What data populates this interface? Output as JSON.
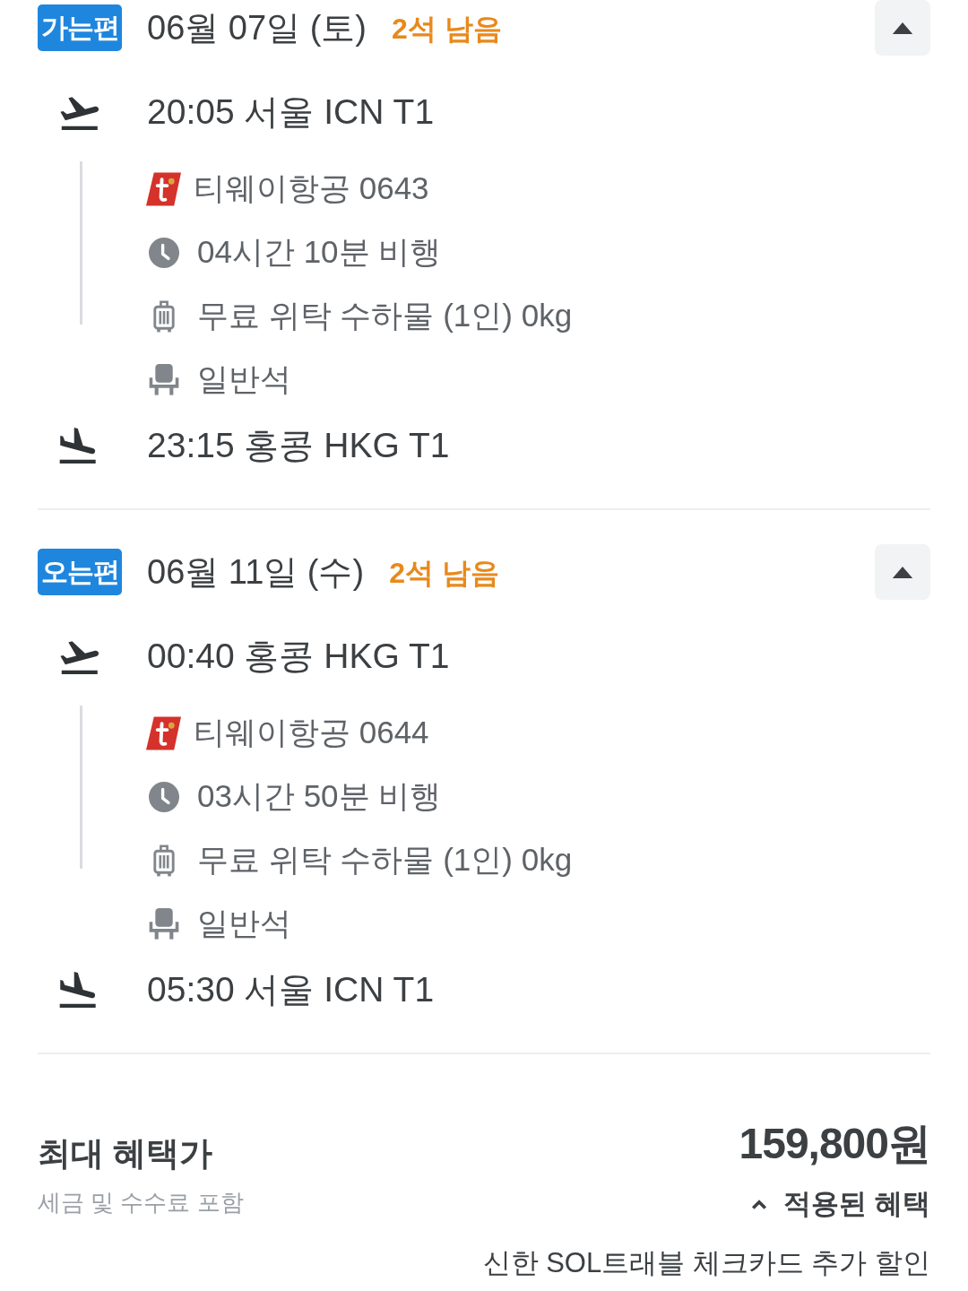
{
  "segments": [
    {
      "tag": "가는편",
      "date": "06월 07일 (토)",
      "seats_left": "2석 남음",
      "expanded": true,
      "departure": "20:05 서울 ICN T1",
      "details": [
        {
          "kind": "airline",
          "text": "티웨이항공 0643"
        },
        {
          "kind": "duration",
          "text": "04시간 10분 비행"
        },
        {
          "kind": "baggage",
          "text": "무료 위탁 수하물 (1인) 0kg"
        },
        {
          "kind": "cabin",
          "text": "일반석"
        }
      ],
      "arrival": "23:15 홍콩 HKG T1"
    },
    {
      "tag": "오는편",
      "date": "06월 11일 (수)",
      "seats_left": "2석 남음",
      "expanded": true,
      "departure": "00:40 홍콩 HKG T1",
      "details": [
        {
          "kind": "airline",
          "text": "티웨이항공 0644"
        },
        {
          "kind": "duration",
          "text": "03시간 50분 비행"
        },
        {
          "kind": "baggage",
          "text": "무료 위탁 수하물 (1인) 0kg"
        },
        {
          "kind": "cabin",
          "text": "일반석"
        }
      ],
      "arrival": "05:30 서울 ICN T1"
    }
  ],
  "price": {
    "label": "최대 혜택가",
    "note": "세금 및 수수료 포함",
    "amount": "159,800원",
    "benefits_toggle": {
      "label": "적용된 혜택",
      "expanded": true
    },
    "benefits": [
      "신한 SOL트래블 체크카드 추가 할인"
    ]
  }
}
